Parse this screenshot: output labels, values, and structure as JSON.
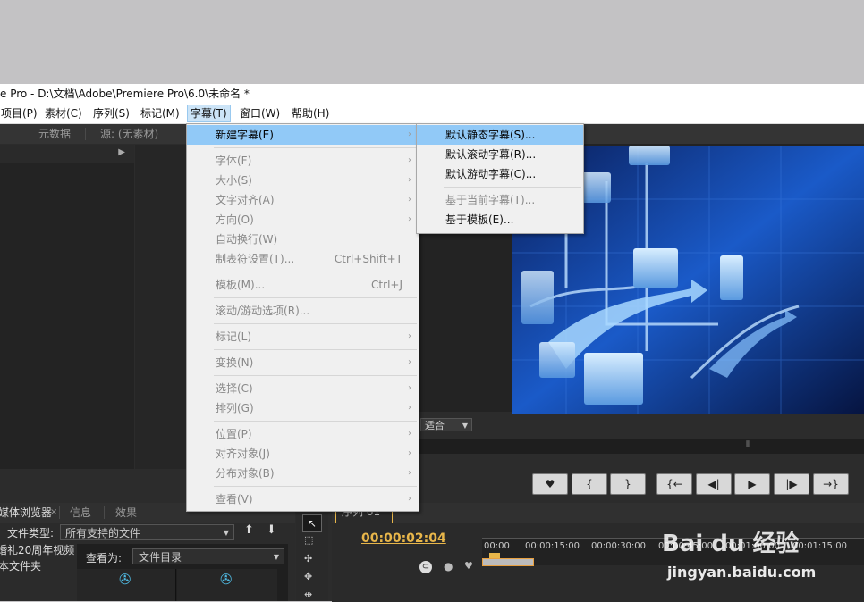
{
  "window": {
    "title": "e Pro - D:\\文档\\Adobe\\Premiere Pro\\6.0\\未命名 *"
  },
  "menubar": {
    "items": [
      "项目(P)",
      "素材(C)",
      "序列(S)",
      "标记(M)",
      "字幕(T)",
      "窗口(W)",
      "帮助(H)"
    ],
    "active": "字幕(T)"
  },
  "source_panel": {
    "tabs": [
      "元数据",
      "源: (无素材)"
    ]
  },
  "title_menu": {
    "items": [
      {
        "label": "新建字幕(E)",
        "shortcut": "",
        "submenu": true
      },
      {
        "label": "字体(F)",
        "shortcut": "",
        "submenu": true
      },
      {
        "label": "大小(S)",
        "shortcut": "",
        "submenu": true
      },
      {
        "label": "文字对齐(A)",
        "shortcut": "",
        "submenu": true
      },
      {
        "label": "方向(O)",
        "shortcut": "",
        "submenu": true
      },
      {
        "label": "自动换行(W)",
        "shortcut": "",
        "submenu": false
      },
      {
        "label": "制表符设置(T)...",
        "shortcut": "Ctrl+Shift+T",
        "submenu": false
      },
      {
        "label": "模板(M)...",
        "shortcut": "Ctrl+J",
        "submenu": false
      },
      {
        "label": "滚动/游动选项(R)...",
        "shortcut": "",
        "submenu": false
      },
      {
        "label": "标记(L)",
        "shortcut": "",
        "submenu": true
      },
      {
        "label": "变换(N)",
        "shortcut": "",
        "submenu": true
      },
      {
        "label": "选择(C)",
        "shortcut": "",
        "submenu": true
      },
      {
        "label": "排列(G)",
        "shortcut": "",
        "submenu": true
      },
      {
        "label": "位置(P)",
        "shortcut": "",
        "submenu": true
      },
      {
        "label": "对齐对象(J)",
        "shortcut": "",
        "submenu": true
      },
      {
        "label": "分布对象(B)",
        "shortcut": "",
        "submenu": true
      },
      {
        "label": "查看(V)",
        "shortcut": "",
        "submenu": true
      }
    ]
  },
  "new_title_submenu": {
    "items": [
      "默认静态字幕(S)...",
      "默认滚动字幕(R)...",
      "默认游动字幕(C)...",
      "基于当前字幕(T)...",
      "基于模板(E)..."
    ]
  },
  "program_monitor": {
    "fit_label": "适合",
    "transport": [
      "♥",
      "{",
      "}",
      "{←",
      "◀|",
      "▶",
      "|▶",
      "→}"
    ]
  },
  "project_panel": {
    "tabs": [
      "媒体浏览器",
      "信息",
      "效果"
    ],
    "file_type_label": "文件类型:",
    "file_type_value": "所有支持的文件",
    "view_as_label": "查看为:",
    "view_as_value": "文件目录",
    "tree_items": [
      "婚礼20周年视频",
      "本文件夹"
    ]
  },
  "timeline": {
    "tab": "序列 01",
    "timecode": "00:00:02:04",
    "ruler": [
      "00:00",
      "00:00:15:00",
      "00:00:30:00",
      "00:00:45:00",
      "00:01:00:00",
      "00:01:15:00"
    ]
  },
  "watermark": {
    "brand": "Bai du 经验",
    "url": "jingyan.baidu.com"
  },
  "colors": {
    "accent": "#91c9f7",
    "timecode": "#e8b64a",
    "panel_bg": "#232323"
  }
}
